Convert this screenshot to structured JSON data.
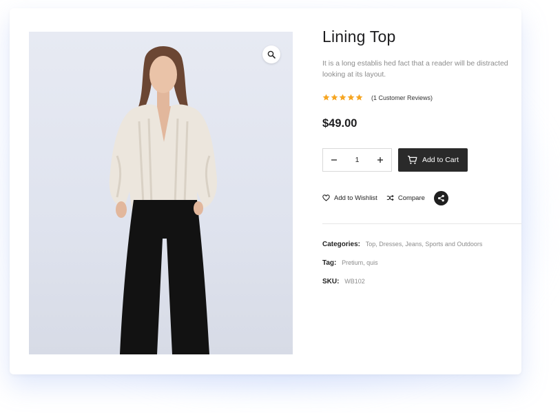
{
  "product": {
    "title": "Lining Top",
    "description": "It is a long establis hed fact that a reader will be distracted looking at its layout.",
    "rating": 5,
    "rating_max": 5,
    "reviews_label": "(1 Customer Reviews)",
    "price": "$49.00"
  },
  "quantity": {
    "value": "1"
  },
  "buttons": {
    "add_to_cart": "Add to Cart",
    "wishlist": "Add to Wishlist",
    "compare": "Compare"
  },
  "meta": {
    "categories_label": "Categories:",
    "categories_value": "Top, Dresses, Jeans, Sports and Outdoors",
    "tag_label": "Tag:",
    "tag_value": "Pretium, quis",
    "sku_label": "SKU:",
    "sku_value": "WB102"
  },
  "icons": {
    "zoom": "magnifier-icon",
    "minus": "minus-icon",
    "plus": "plus-icon",
    "cart": "cart-icon",
    "wishlist": "heart-icon",
    "compare": "shuffle-icon",
    "share": "share-icon",
    "star": "star-icon"
  },
  "colors": {
    "star": "#f6a623",
    "cart_button": "#2a2a2a",
    "text_primary": "#1d1d1f",
    "text_muted": "#8c8c8c"
  }
}
